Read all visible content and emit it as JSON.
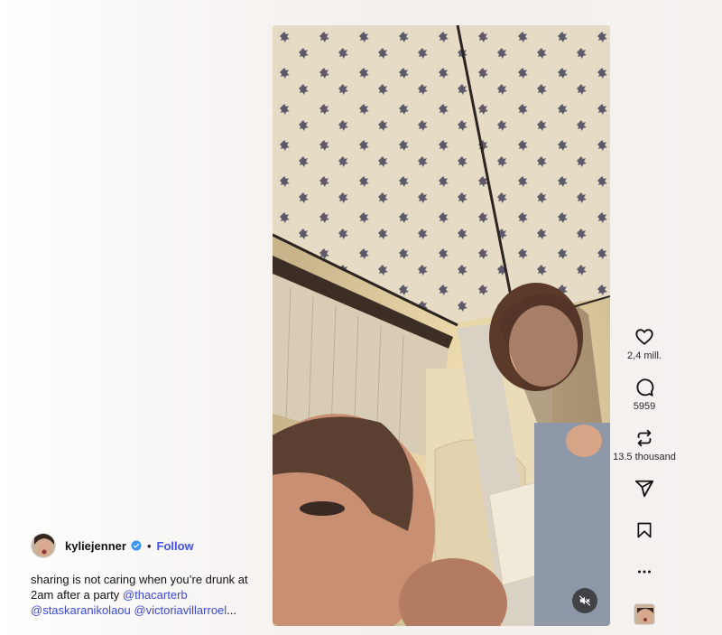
{
  "post": {
    "username": "kylie​jenner",
    "dot": "•",
    "follow_label": "Follow",
    "caption_text": "sharing is not caring when you’re drunk at 2am after a party",
    "mention_1": "@thacarterb",
    "mention_2": "@staskaranikolaou",
    "mention_3": "@victoriavillarroel",
    "ellipsis": "..."
  },
  "actions": {
    "like_count": "2,4 mill.",
    "comment_count": "5959",
    "repost_count": "13.5 thousand"
  },
  "icons": {
    "like": "heart-icon",
    "comment": "comment-icon",
    "repost": "repost-icon",
    "share": "send-icon",
    "save": "bookmark-icon",
    "more": "more-icon",
    "mute": "speaker-muted-icon",
    "verified": "verified-badge-icon"
  },
  "colors": {
    "accent": "#4150f7",
    "mention": "#3b48d8",
    "verified": "#3897f0"
  }
}
